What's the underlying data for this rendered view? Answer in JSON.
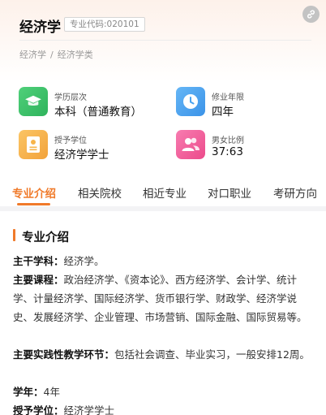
{
  "header": {
    "title": "经济学",
    "code_badge": "专业代码:020101",
    "breadcrumb": [
      "经济学",
      "经济学类"
    ],
    "breadcrumb_separator": "/"
  },
  "info": [
    {
      "label": "学历层次",
      "value": "本科（普通教育）",
      "icon": "graduation-cap-icon",
      "color": "#3cc76a"
    },
    {
      "label": "修业年限",
      "value": "四年",
      "icon": "clock-icon",
      "color": "#4aa3f0"
    },
    {
      "label": "授予学位",
      "value": "经济学学士",
      "icon": "certificate-icon",
      "color": "#f7b449"
    },
    {
      "label": "男女比例",
      "value": "37:63",
      "icon": "people-icon",
      "color": "#f25c9b"
    }
  ],
  "tabs": [
    "专业介绍",
    "相关院校",
    "相近专业",
    "对口职业",
    "考研方向"
  ],
  "active_tab": "专业介绍",
  "section": {
    "title": "专业介绍",
    "paragraphs": [
      {
        "label": "主干学科：",
        "text": "经济学。"
      },
      {
        "label": "主要课程：",
        "text": "政治经济学、《资本论》、西方经济学、会计学、统计学、计量经济学、国际经济学、货币银行学、财政学、经济学说史、发展经济学、企业管理、市场营销、国际金融、国际贸易等。"
      },
      {
        "label": "主要实践性教学环节：",
        "text": "包括社会调查、毕业实习，一般安排12周。"
      },
      {
        "label": "学年：",
        "text": "4年"
      },
      {
        "label": "授予学位：",
        "text": "经济学学士"
      }
    ]
  },
  "colors": {
    "accent": "#f07a2a"
  }
}
